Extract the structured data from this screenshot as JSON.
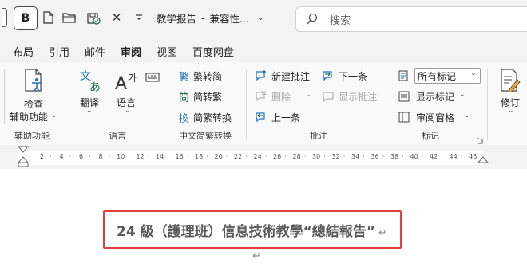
{
  "titlebar": {
    "doc_title": "教学报告",
    "separator": "-",
    "mode": "兼容性...",
    "search_placeholder": "搜索"
  },
  "tabs": [
    {
      "label": "布局",
      "active": false
    },
    {
      "label": "引用",
      "active": false
    },
    {
      "label": "邮件",
      "active": false
    },
    {
      "label": "审阅",
      "active": true
    },
    {
      "label": "视图",
      "active": false
    },
    {
      "label": "百度网盘",
      "active": false
    }
  ],
  "ribbon": {
    "accessibility": {
      "check_line1": "检查",
      "check_line2": "辅助功能",
      "group": "辅助功能"
    },
    "language": {
      "translate": "翻译",
      "language": "语言",
      "group": "语言"
    },
    "chinese": {
      "to_simplified": "繁转简",
      "to_traditional": "简转繁",
      "convert": "简繁转换",
      "group": "中文简繁转换"
    },
    "comments": {
      "new": "新建批注",
      "delete": "删除",
      "previous": "上一条",
      "next": "下一条",
      "show": "显示批注",
      "group": "批注"
    },
    "tracking": {
      "markup_select": "所有标记",
      "show_markup": "显示标记",
      "reviewing_pane": "审阅窗格",
      "group": "标记"
    },
    "changes": {
      "revise": "修订"
    }
  },
  "ruler": {
    "ticks": [
      "2",
      "4",
      "6",
      "8",
      "10",
      "12",
      "14",
      "16",
      "18",
      "20",
      "22",
      "24",
      "26",
      "28",
      "30",
      "32",
      "34",
      "36",
      "38",
      "40",
      "42",
      "44",
      "46"
    ]
  },
  "document": {
    "heading": "24 級（護理班）信息技術教學“總結報告”",
    "paragraph_mark": "↵"
  },
  "colors": {
    "accent": "#1f6b47",
    "highlight_border": "#e0403a",
    "chrome": "#f3f3f3"
  }
}
